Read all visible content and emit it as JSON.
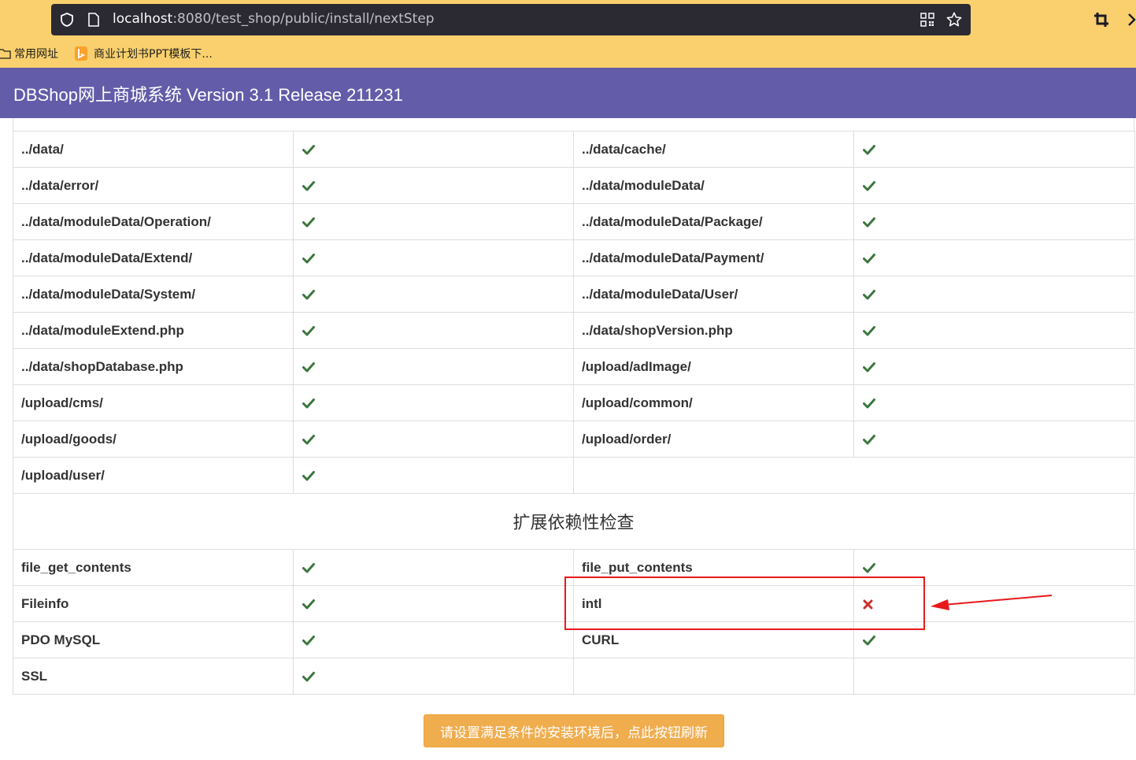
{
  "browser": {
    "url_host": "localhost",
    "url_path": ":8080/test_shop/public/install/nextStep",
    "bookmarks": [
      {
        "label": "常用网址",
        "icon": "folder-icon"
      },
      {
        "label": "商业计划书PPT模板下...",
        "icon": "bing-icon"
      }
    ]
  },
  "header": {
    "title": "DBShop网上商城系统 Version 3.1 Release 211231",
    "bg_color": "#635ca8"
  },
  "dirs": {
    "rows": [
      [
        {
          "name": "../data/",
          "ok": true
        },
        {
          "name": "../data/cache/",
          "ok": true
        }
      ],
      [
        {
          "name": "../data/error/",
          "ok": true
        },
        {
          "name": "../data/moduleData/",
          "ok": true
        }
      ],
      [
        {
          "name": "../data/moduleData/Operation/",
          "ok": true
        },
        {
          "name": "../data/moduleData/Package/",
          "ok": true
        }
      ],
      [
        {
          "name": "../data/moduleData/Extend/",
          "ok": true
        },
        {
          "name": "../data/moduleData/Payment/",
          "ok": true
        }
      ],
      [
        {
          "name": "../data/moduleData/System/",
          "ok": true
        },
        {
          "name": "../data/moduleData/User/",
          "ok": true
        }
      ],
      [
        {
          "name": "../data/moduleExtend.php",
          "ok": true
        },
        {
          "name": "../data/shopVersion.php",
          "ok": true
        }
      ],
      [
        {
          "name": "../data/shopDatabase.php",
          "ok": true
        },
        {
          "name": "/upload/adImage/",
          "ok": true
        }
      ],
      [
        {
          "name": "/upload/cms/",
          "ok": true
        },
        {
          "name": "/upload/common/",
          "ok": true
        }
      ],
      [
        {
          "name": "/upload/goods/",
          "ok": true
        },
        {
          "name": "/upload/order/",
          "ok": true
        }
      ],
      [
        {
          "name": "/upload/user/",
          "ok": true
        }
      ]
    ]
  },
  "extensions": {
    "section_title": "扩展依赖性检查",
    "rows": [
      [
        {
          "name": "file_get_contents",
          "ok": true
        },
        {
          "name": "file_put_contents",
          "ok": true
        }
      ],
      [
        {
          "name": "Fileinfo",
          "ok": true
        },
        {
          "name": "intl",
          "ok": false
        }
      ],
      [
        {
          "name": "PDO MySQL",
          "ok": true
        },
        {
          "name": "CURL",
          "ok": true
        }
      ],
      [
        {
          "name": "SSL",
          "ok": true
        },
        {
          "name": "",
          "ok": null
        }
      ]
    ]
  },
  "colors": {
    "ok": "#3c763d",
    "fail": "#c9302c",
    "button": "#f0ad4e",
    "annotation": "#e8191a"
  },
  "refresh_button": {
    "label": "请设置满足条件的安装环境后，点此按钮刷新"
  }
}
